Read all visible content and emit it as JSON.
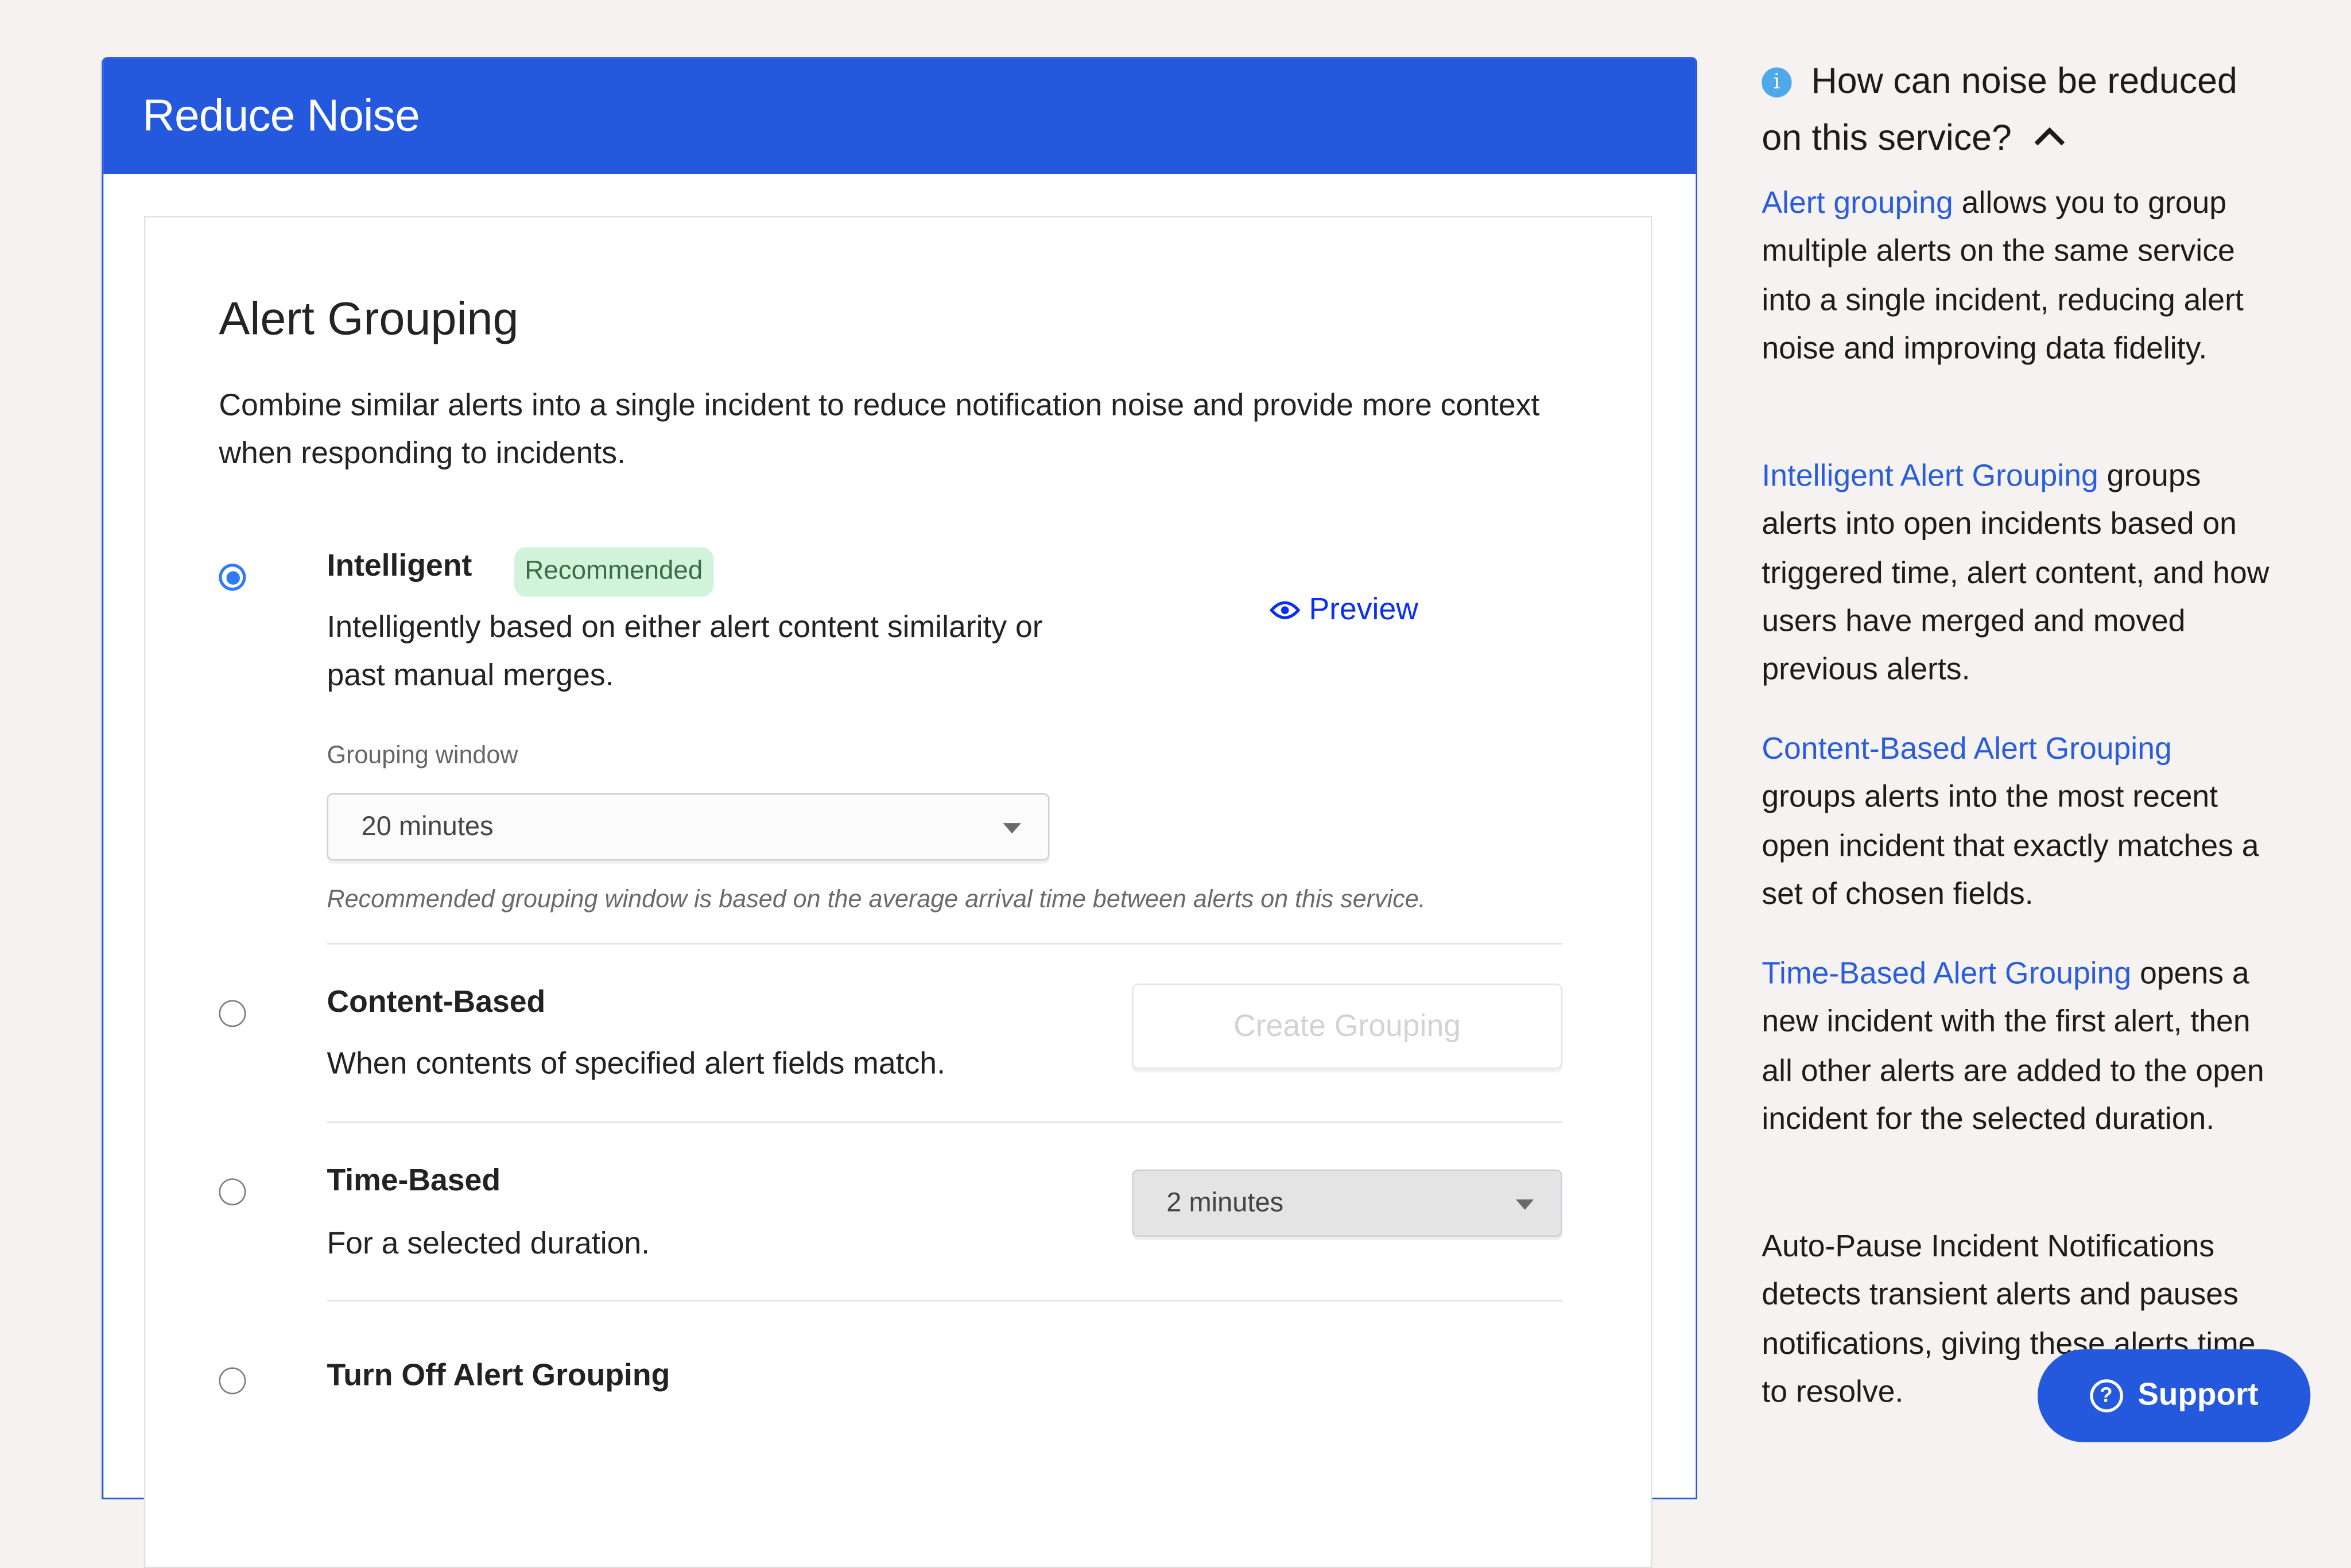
{
  "panel": {
    "title": "Reduce Noise"
  },
  "alert_grouping": {
    "heading": "Alert Grouping",
    "description": "Combine similar alerts into a single incident to reduce notification noise and provide more context when responding to incidents.",
    "options": [
      {
        "title": "Intelligent",
        "badge": "Recommended",
        "description": "Intelligently based on either alert content similarity or past manual merges.",
        "selected": true,
        "preview_label": "Preview",
        "grouping_window_label": "Grouping window",
        "grouping_window_value": "20 minutes",
        "hint": "Recommended grouping window is based on the average arrival time between alerts on this service."
      },
      {
        "title": "Content-Based",
        "description": "When contents of specified alert fields match.",
        "selected": false,
        "action_label": "Create Grouping"
      },
      {
        "title": "Time-Based",
        "description": "For a selected duration.",
        "selected": false,
        "duration_value": "2 minutes"
      },
      {
        "title": "Turn Off Alert Grouping",
        "selected": false
      }
    ]
  },
  "sidebar": {
    "question": "How can noise be reduced on this service?",
    "sections": [
      {
        "link": "Alert grouping",
        "text": " allows you to group multiple alerts on the same service into a single incident, reducing alert noise and improving data fidelity."
      },
      {
        "link": "Intelligent Alert Grouping",
        "text": " groups alerts into open incidents based on triggered time, alert content, and how users have merged and moved previous alerts."
      },
      {
        "link": "Content-Based Alert Grouping",
        "text": " groups alerts into the most recent open incident that exactly matches a set of chosen fields."
      },
      {
        "link": "Time-Based Alert Grouping",
        "text": " opens a new incident with the first alert, then all other alerts are added to the open incident for the selected duration."
      },
      {
        "text": "Auto-Pause Incident Notifications detects transient alerts and pauses notifications, giving these alerts time to resolve."
      }
    ]
  },
  "support": {
    "label": "Support"
  },
  "colors": {
    "brand_blue": "#2559dd",
    "link_blue": "#2a5ddc",
    "preview_blue": "#0a2ff1",
    "radio_blue": "#2f7af5",
    "badge_bg": "#d0f3da",
    "badge_text": "#3c6b47",
    "info_blue": "#4ea8ea"
  }
}
